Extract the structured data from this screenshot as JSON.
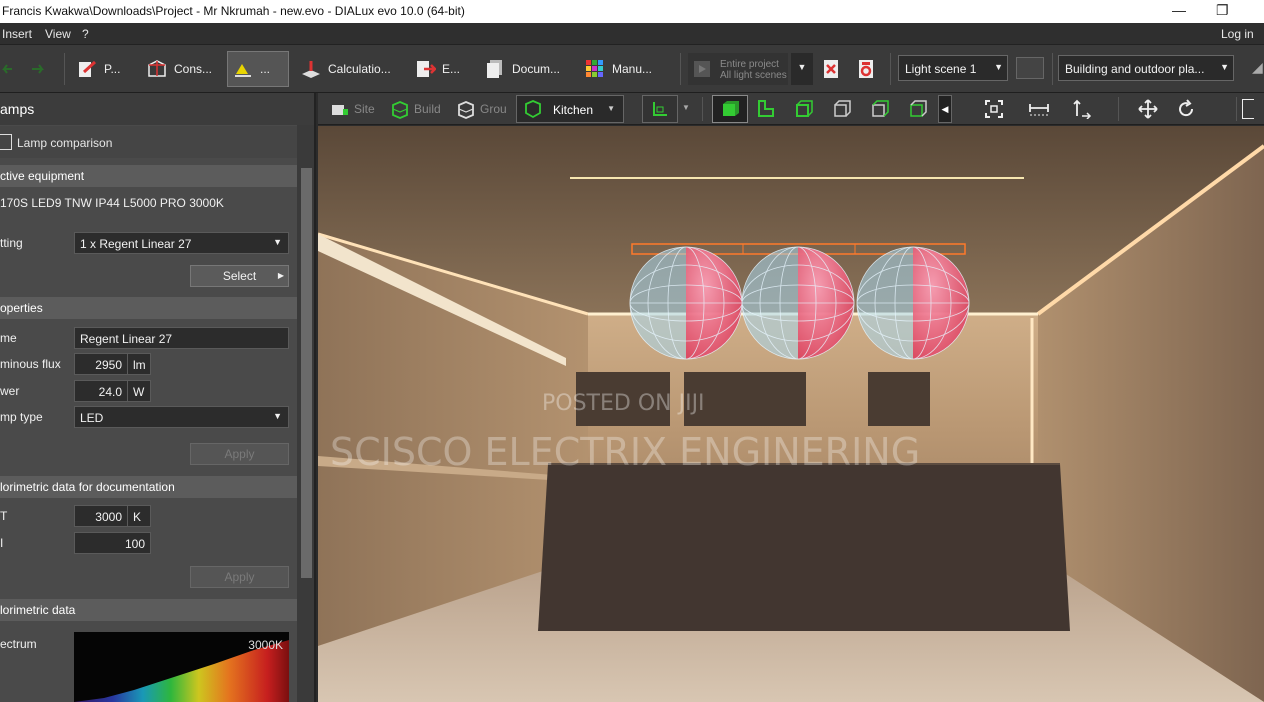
{
  "window": {
    "title": "Francis Kwakwa\\Downloads\\Project - Mr Nkrumah - new.evo - DIALux evo 10.0  (64-bit)",
    "minimize_glyph": "—",
    "restore_glyph": "❐"
  },
  "menu": {
    "items": [
      "Insert",
      "View",
      "?"
    ],
    "login": "Log in"
  },
  "toolbar": {
    "tabs": [
      {
        "label": "P...",
        "icon": "project-icon"
      },
      {
        "label": "Cons...",
        "icon": "construction-icon"
      },
      {
        "label": "...",
        "icon": "light-icon",
        "active": true
      },
      {
        "label": "Calculatio...",
        "icon": "calculation-icon"
      },
      {
        "label": "E...",
        "icon": "export-icon"
      },
      {
        "label": "Docum...",
        "icon": "documentation-icon"
      },
      {
        "label": "Manu...",
        "icon": "manufacturer-icon"
      }
    ],
    "scope_line1": "Entire project",
    "scope_line2": "All light scenes",
    "light_scene": "Light scene 1",
    "view_mode": "Building and outdoor pla..."
  },
  "panel": {
    "title": "amps",
    "lamp_comparison": "Lamp comparison",
    "active_equipment": {
      "header": "ctive equipment",
      "product": "170S LED9 TNW IP44 L5000 PRO 3000K",
      "fitting_label": "tting",
      "fitting_value": "1 x Regent Linear 27",
      "select_label": "Select"
    },
    "properties": {
      "header": "operties",
      "name_label": "me",
      "name_value": "Regent Linear 27",
      "flux_label": "minous flux",
      "flux_value": "2950",
      "flux_unit": "lm",
      "power_label": "wer",
      "power_value": "24.0",
      "power_unit": "W",
      "lamp_type_label": "mp type",
      "lamp_type_value": "LED",
      "apply_label": "Apply"
    },
    "colorimetric_doc": {
      "header": "lorimetric data for documentation",
      "cct_label": "T",
      "cct_value": "3000",
      "cct_unit": "K",
      "cri_label": "I",
      "cri_value": "100",
      "apply_label": "Apply"
    },
    "colorimetric": {
      "header": "lorimetric data",
      "spectrum_label": "ectrum",
      "spectrum_cct": "3000K"
    }
  },
  "viewport_toolbar": {
    "site": "Site",
    "building": "Build",
    "ground": "Grou",
    "room": "Kitchen"
  },
  "watermarks": {
    "posted": "POSTED ON JIJI",
    "company": "SCISCO ELECTRIX ENGINERING"
  },
  "colors": {
    "accent_green": "#2fb52f",
    "luminaire_orange": "#ff7a2a"
  }
}
